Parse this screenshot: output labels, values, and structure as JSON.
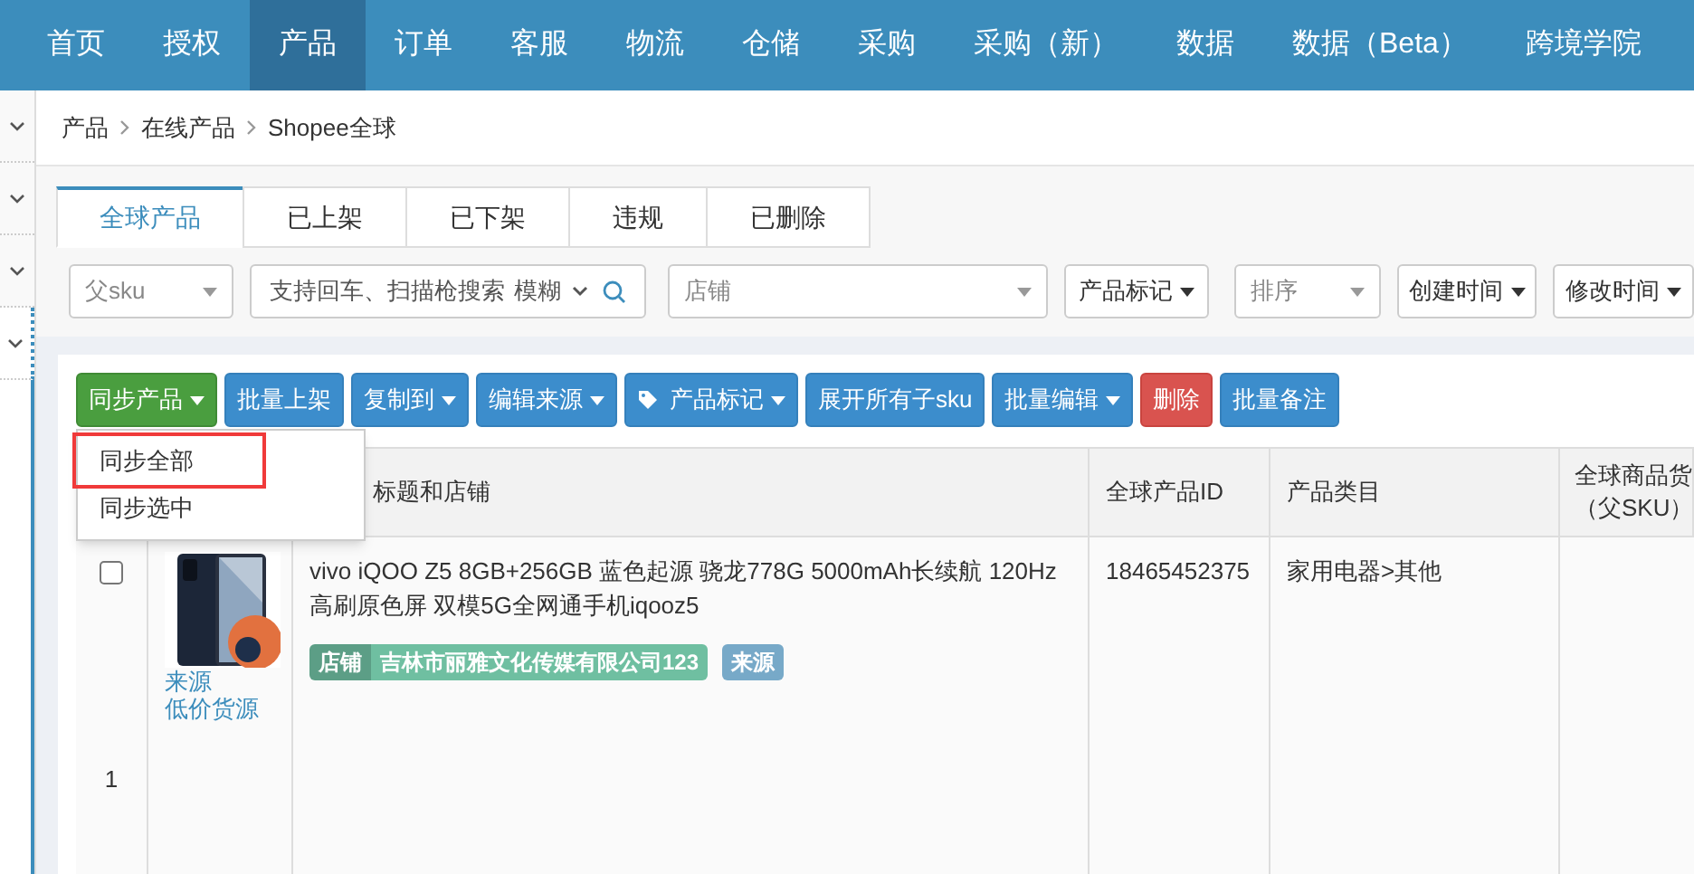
{
  "nav": {
    "items": [
      {
        "label": "首页",
        "selected": false
      },
      {
        "label": "授权",
        "selected": false
      },
      {
        "label": "产品",
        "selected": true
      },
      {
        "label": "订单",
        "selected": false
      },
      {
        "label": "客服",
        "selected": false
      },
      {
        "label": "物流",
        "selected": false
      },
      {
        "label": "仓储",
        "selected": false
      },
      {
        "label": "采购",
        "selected": false
      },
      {
        "label": "采购（新）",
        "selected": false
      },
      {
        "label": "数据",
        "selected": false
      },
      {
        "label": "数据（Beta）",
        "selected": false
      },
      {
        "label": "跨境学院",
        "selected": false
      }
    ]
  },
  "sidebar": {
    "items": [
      {
        "selected": false
      },
      {
        "selected": false
      },
      {
        "selected": false
      },
      {
        "selected": true
      }
    ]
  },
  "breadcrumb": [
    "产品",
    "在线产品",
    "Shopee全球"
  ],
  "tabs": [
    {
      "label": "全球产品",
      "selected": true
    },
    {
      "label": "已上架",
      "selected": false
    },
    {
      "label": "已下架",
      "selected": false
    },
    {
      "label": "违规",
      "selected": false
    },
    {
      "label": "已删除",
      "selected": false
    }
  ],
  "filters": [
    {
      "kind": "select",
      "placeholder": "父sku"
    },
    {
      "kind": "search",
      "placeholder": "支持回车、扫描枪搜索",
      "mode": "模糊"
    },
    {
      "kind": "select",
      "placeholder": "店铺"
    },
    {
      "kind": "button",
      "label": "产品标记"
    },
    {
      "kind": "select",
      "placeholder": "排序"
    },
    {
      "kind": "button",
      "label": "创建时间"
    },
    {
      "kind": "button",
      "label": "修改时间"
    }
  ],
  "toolbar": [
    {
      "label": "同步产品",
      "kind": "success",
      "caret": true
    },
    {
      "label": "批量上架",
      "kind": "primary",
      "caret": false
    },
    {
      "label": "复制到",
      "kind": "primary",
      "caret": true
    },
    {
      "label": "编辑来源",
      "kind": "primary",
      "caret": true
    },
    {
      "label": "产品标记",
      "kind": "tag",
      "caret": true
    },
    {
      "label": "展开所有子sku",
      "kind": "primary",
      "caret": false
    },
    {
      "label": "批量编辑",
      "kind": "primary",
      "caret": true
    },
    {
      "label": "删除",
      "kind": "danger",
      "caret": false
    },
    {
      "label": "批量备注",
      "kind": "primary",
      "caret": false
    }
  ],
  "dropdown_menu": {
    "items": [
      {
        "label": "同步全部",
        "annotated": true
      },
      {
        "label": "同步选中",
        "annotated": false
      }
    ]
  },
  "table": {
    "columns": [
      {
        "lines": [
          "标题和店铺"
        ]
      },
      {
        "lines": [
          "全球产品ID"
        ]
      },
      {
        "lines": [
          "产品类目"
        ]
      },
      {
        "lines": [
          "全球商品货",
          "（父SKU）"
        ]
      }
    ],
    "rows": [
      {
        "checked": false,
        "index": "1",
        "image": {
          "kind": "picture"
        },
        "links": [
          "来源",
          "低价货源"
        ],
        "title": "vivo iQOO Z5 8GB+256GB 蓝色起源 骁龙778G 5000mAh长续航 120Hz高刷原色屏 双模5G全网通手机iqooz5",
        "tags": [
          {
            "kind": "store",
            "label": "店铺",
            "value": "吉林市丽雅文化传媒有限公司123"
          },
          {
            "kind": "source",
            "label": "来源"
          }
        ],
        "product_id": "18465452375",
        "category": "家用电器>其他"
      }
    ]
  }
}
